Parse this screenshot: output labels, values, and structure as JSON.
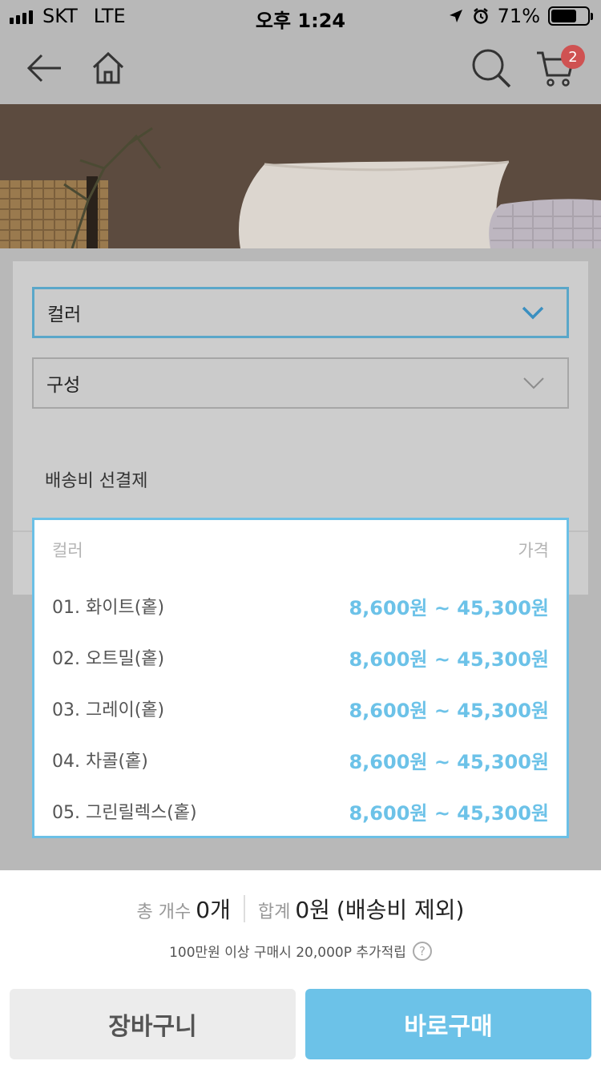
{
  "status_bar": {
    "carrier": "SKT",
    "network": "LTE",
    "time": "오후 1:24",
    "battery": "71%",
    "battery_level": 0.71
  },
  "header": {
    "cart_count": "2",
    "icons": [
      "back-arrow-icon",
      "home-icon",
      "search-icon",
      "cart-icon"
    ]
  },
  "options": {
    "color_select": "컬러",
    "config_select": "구성",
    "shipping": "배송비 선결제"
  },
  "dropdown": {
    "header_name": "컬러",
    "header_price": "가격",
    "items": [
      {
        "name": "01. 화이트(홑)",
        "price": "8,600원 ~ 45,300원"
      },
      {
        "name": "02. 오트밀(홑)",
        "price": "8,600원 ~ 45,300원"
      },
      {
        "name": "03. 그레이(홑)",
        "price": "8,600원 ~ 45,300원"
      },
      {
        "name": "04. 차콜(홑)",
        "price": "8,600원 ~ 45,300원"
      },
      {
        "name": "05. 그린릴렉스(홑)",
        "price": "8,600원 ~ 45,300원"
      }
    ]
  },
  "summary": {
    "count_label": "총 개수",
    "count_value": "0개",
    "total_label": "합계",
    "total_value": "0원",
    "total_note": "(배송비 제외)",
    "point_note": "100만원 이상 구매시 20,000P 추가적립",
    "help": "?"
  },
  "actions": {
    "cart_label": "장바구니",
    "buy_label": "바로구매"
  },
  "colors": {
    "accent": "#6cc2e8",
    "badge": "#cf5252"
  }
}
